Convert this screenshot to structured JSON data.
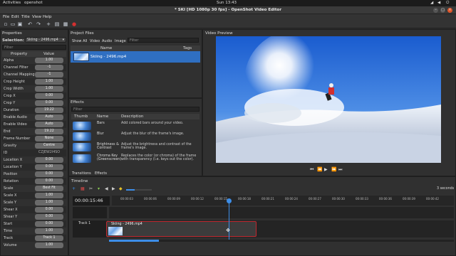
{
  "topbar": {
    "activities": "Activities",
    "app": "openshot",
    "clock": "Sun 13:43"
  },
  "window": {
    "title": "* SKI [HD 1080p 30 fps] - OpenShot Video Editor"
  },
  "menu": [
    "File",
    "Edit",
    "Title",
    "View",
    "Help"
  ],
  "properties": {
    "title": "Properties",
    "selection_label": "Selection:",
    "selection_value": "Skiing - 2496.mp4",
    "filter_placeholder": "Filter",
    "col_property": "Property",
    "col_value": "Value",
    "rows": [
      {
        "name": "Alpha",
        "value": "1.00"
      },
      {
        "name": "Channel Filter",
        "value": "-1"
      },
      {
        "name": "Channel Mapping",
        "value": "-1"
      },
      {
        "name": "Crop Height",
        "value": "1.00"
      },
      {
        "name": "Crop Width",
        "value": "1.00"
      },
      {
        "name": "Crop X",
        "value": "0.00"
      },
      {
        "name": "Crop Y",
        "value": "0.00"
      },
      {
        "name": "Duration",
        "value": "19.22"
      },
      {
        "name": "Enable Audio",
        "value": "Auto"
      },
      {
        "name": "Enable Video",
        "value": "Auto"
      },
      {
        "name": "End",
        "value": "19.22"
      },
      {
        "name": "Frame Number",
        "value": "None"
      },
      {
        "name": "Gravity",
        "value": "Centre"
      },
      {
        "name": "ID",
        "value": "CZJEW2I4SO"
      },
      {
        "name": "Location X",
        "value": "0.00"
      },
      {
        "name": "Location Y",
        "value": "0.00"
      },
      {
        "name": "Position",
        "value": "0.00"
      },
      {
        "name": "Rotation",
        "value": "0.00"
      },
      {
        "name": "Scale",
        "value": "Best Fit"
      },
      {
        "name": "Scale X",
        "value": "1.00"
      },
      {
        "name": "Scale Y",
        "value": "1.00"
      },
      {
        "name": "Shear X",
        "value": "0.00"
      },
      {
        "name": "Shear Y",
        "value": "0.00"
      },
      {
        "name": "Start",
        "value": "0.00"
      },
      {
        "name": "Time",
        "value": "1.00"
      },
      {
        "name": "Track",
        "value": "Track 1"
      },
      {
        "name": "Volume",
        "value": "1.00"
      }
    ]
  },
  "project_files": {
    "title": "Project Files",
    "filters": [
      "Show All",
      "Video",
      "Audio",
      "Image"
    ],
    "filter_placeholder": "Filter",
    "col_name": "Name",
    "col_tags": "Tags",
    "files": [
      {
        "name": "Skiing - 2496.mp4"
      }
    ]
  },
  "effects": {
    "title": "Effects",
    "filter_placeholder": "Filter",
    "col_thumb": "Thumb",
    "col_name": "Name",
    "col_desc": "Description",
    "items": [
      {
        "name": "Bars",
        "desc": "Add colored bars around your video."
      },
      {
        "name": "Blur",
        "desc": "Adjust the blur of the frame's image."
      },
      {
        "name": "Brightness & Contrast",
        "desc": "Adjust the brightness and contrast of the frame's image."
      },
      {
        "name": "Chroma Key (Greenscreen)",
        "desc": "Replaces the color (or chroma) of the frame with transparency (i.e. keys out the color)."
      }
    ],
    "tabs": [
      "Transitions",
      "Effects"
    ]
  },
  "preview": {
    "title": "Video Preview"
  },
  "timeline": {
    "title": "Timeline",
    "timecode": "00:00:15:46",
    "zoom_label": "3 seconds",
    "ruler": [
      "00:00:03",
      "00:00:06",
      "00:00:09",
      "00:00:12",
      "00:00:15",
      "00:00:18",
      "00:00:21",
      "00:00:24",
      "00:00:27",
      "00:00:30",
      "00:00:33",
      "00:00:36",
      "00:00:39",
      "00:00:42"
    ],
    "track_name": "Track 1",
    "clip_name": "Skiing - 2496.mp4"
  },
  "colors": {
    "accent": "#2f6fc1",
    "clip_border": "#c0282f",
    "playhead": "#3d8ee8"
  }
}
